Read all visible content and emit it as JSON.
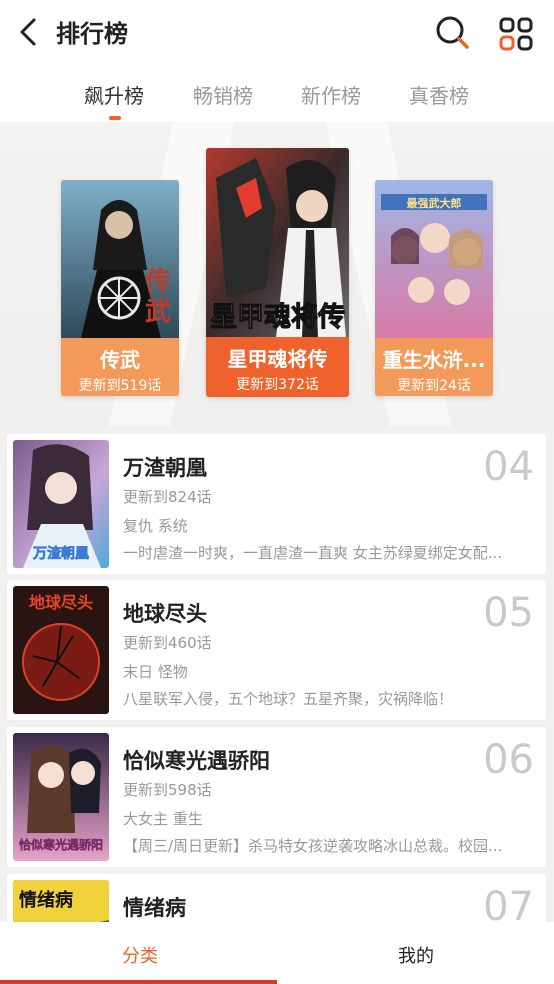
{
  "header": {
    "title": "排行榜"
  },
  "tabs": [
    {
      "label": "飙升榜",
      "active": true
    },
    {
      "label": "畅销榜",
      "active": false
    },
    {
      "label": "新作榜",
      "active": false
    },
    {
      "label": "真香榜",
      "active": false
    }
  ],
  "podium": [
    {
      "rank": "2",
      "title": "传武",
      "update": "更新到519话"
    },
    {
      "rank": "1",
      "title": "星甲魂将传",
      "update": "更新到372话"
    },
    {
      "rank": "3",
      "title": "重生水浒...",
      "update": "更新到24话"
    }
  ],
  "list": [
    {
      "rank": "04",
      "title": "万渣朝凰",
      "update": "更新到824话",
      "tags": "复仇 系统",
      "desc": "一时虐渣一时爽，一直虐渣一直爽 女主苏绿夏绑定女配..."
    },
    {
      "rank": "05",
      "title": "地球尽头",
      "update": "更新到460话",
      "tags": "末日 怪物",
      "desc": "八星联军入侵，五个地球？五星齐聚，灾祸降临！"
    },
    {
      "rank": "06",
      "title": "恰似寒光遇骄阳",
      "update": "更新到598话",
      "tags": "大女主 重生",
      "desc": "【周三/周日更新】杀马特女孩逆袭攻略冰山总裁。校园..."
    },
    {
      "rank": "07",
      "title": "情绪病",
      "update": "",
      "tags": "",
      "desc": ""
    }
  ],
  "bottom_nav": {
    "category": "分类",
    "mine": "我的"
  },
  "colors": {
    "accent": "#f0622c",
    "podium_caption": "#f39a5a",
    "nav_underline": "#d63b1f"
  }
}
